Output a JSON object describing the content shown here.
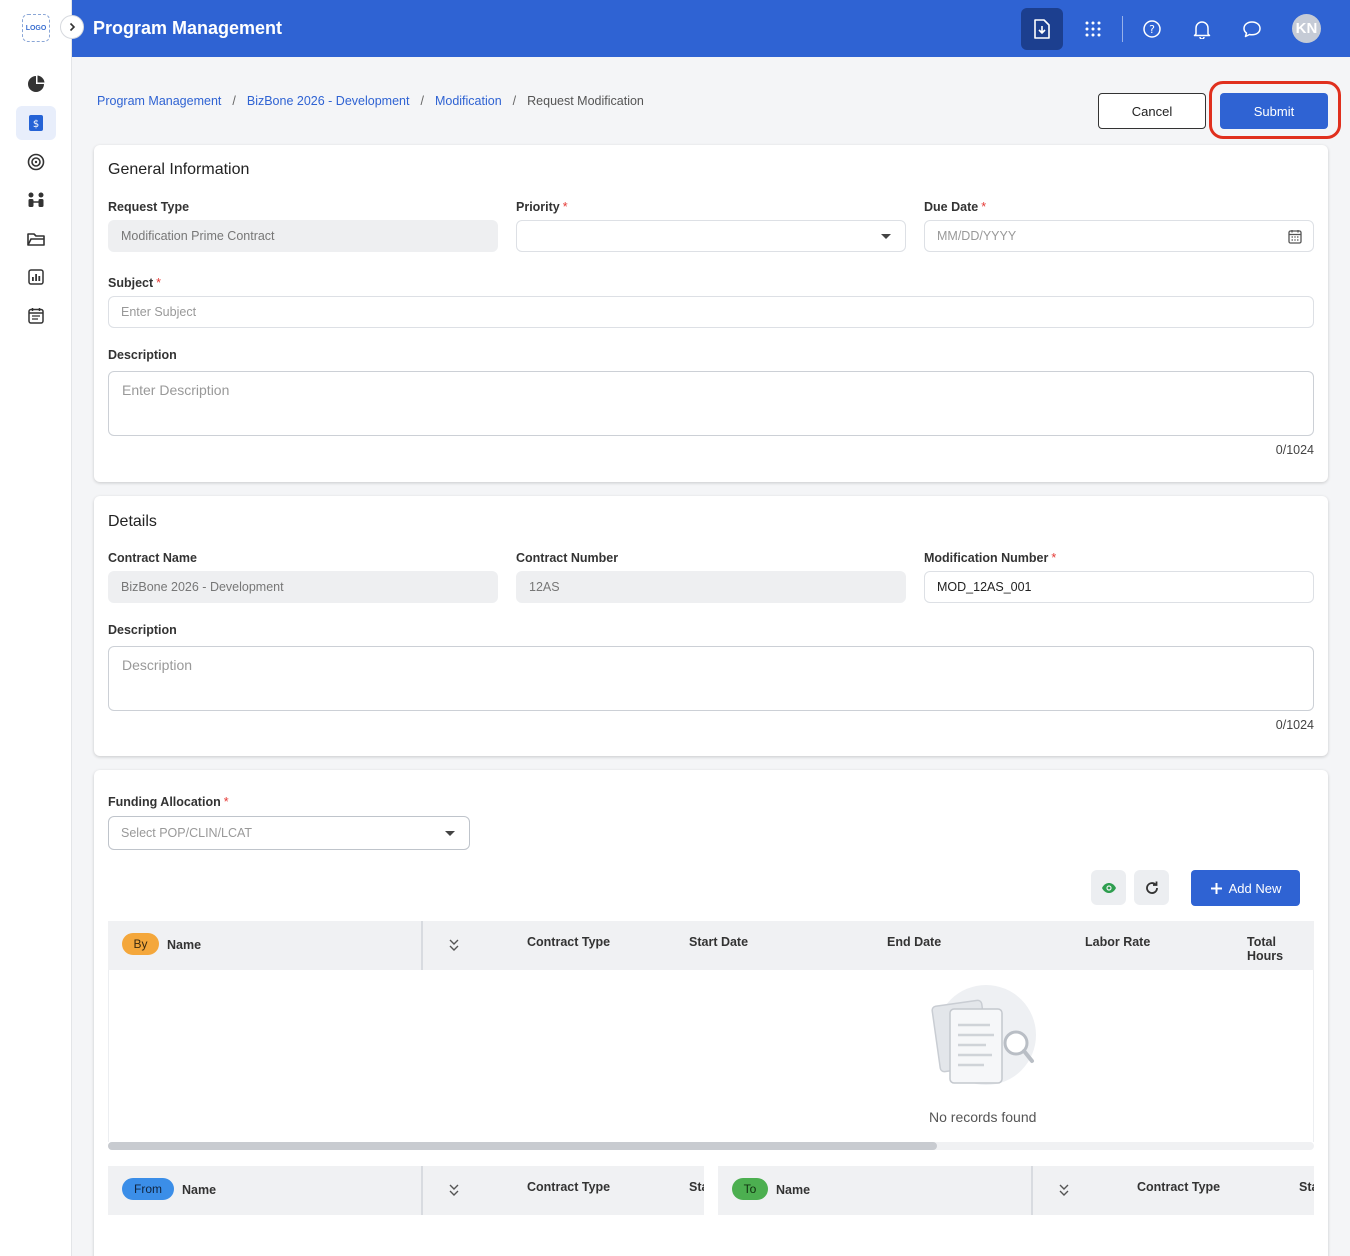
{
  "sidebar": {
    "logo": "LOGO",
    "icons": [
      "pie-chart-icon",
      "budget-icon",
      "target-icon",
      "team-icon",
      "folder-icon",
      "report-icon",
      "calendar-icon"
    ],
    "active_index": 1
  },
  "header": {
    "title": "Program Management",
    "avatar_initials": "KN"
  },
  "breadcrumb": {
    "items": [
      "Program Management",
      "BizBone 2026 - Development",
      "Modification"
    ],
    "current": "Request Modification"
  },
  "actions": {
    "cancel_label": "Cancel",
    "submit_label": "Submit"
  },
  "general": {
    "title": "General Information",
    "request_type_label": "Request Type",
    "request_type_value": "Modification Prime Contract",
    "priority_label": "Priority",
    "due_date_label": "Due Date",
    "due_date_placeholder": "MM/DD/YYYY",
    "subject_label": "Subject",
    "subject_placeholder": "Enter Subject",
    "description_label": "Description",
    "description_placeholder": "Enter Description",
    "counter": "0/1024",
    "required_mark": "*"
  },
  "details": {
    "title": "Details",
    "contract_name_label": "Contract Name",
    "contract_name_value": "BizBone 2026 - Development",
    "contract_number_label": "Contract Number",
    "contract_number_value": "12AS",
    "mod_number_label": "Modification Number",
    "mod_number_value": "MOD_12AS_001",
    "description_label": "Description",
    "description_placeholder": "Description",
    "counter": "0/1024"
  },
  "funding": {
    "label": "Funding Allocation",
    "select_placeholder": "Select POP/CLIN/LCAT",
    "add_new_label": "Add New",
    "by_pill": "By",
    "from_pill": "From",
    "to_pill": "To",
    "columns": {
      "name": "Name",
      "contract_type": "Contract Type",
      "start_date": "Start Date",
      "end_date": "End Date",
      "labor_rate": "Labor Rate",
      "total_hours": "Total Hours",
      "start_trunc": "Sta"
    },
    "empty_text": "No records found"
  },
  "colors": {
    "primary": "#2f63d3",
    "by_pill": "#f4a73b",
    "from_pill": "#3b8ee8",
    "to_pill": "#4caf50",
    "highlight": "#e0301e"
  }
}
